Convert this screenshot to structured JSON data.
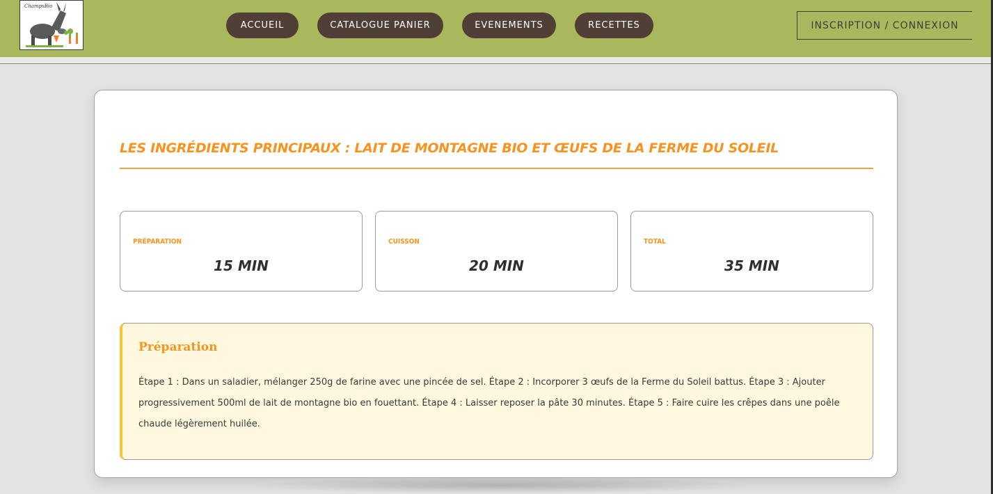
{
  "header": {
    "logo_text": "ChampsBio",
    "nav": {
      "accueil": "ACCUEIL",
      "catalogue": "CATALOGUE PANIER",
      "evenements": "EVENEMENTS",
      "recettes": "RECETTES"
    },
    "login_label": "INSCRIPTION / CONNEXION"
  },
  "recipe": {
    "title": "Les ingrédients principaux : Lait de montagne bio et œufs de la Ferme du Soleil",
    "times": [
      {
        "label": "Préparation",
        "value": "15 min"
      },
      {
        "label": "Cuisson",
        "value": "20 min"
      },
      {
        "label": "Total",
        "value": "35 min"
      }
    ],
    "preparation": {
      "heading": "Préparation",
      "text": "Étape 1 : Dans un saladier, mélanger 250g de farine avec une pincée de sel. Étape 2 : Incorporer 3 œufs de la Ferme du Soleil battus. Étape 3 : Ajouter progressivement 500ml de lait de montagne bio en fouettant. Étape 4 : Laisser reposer la pâte 30 minutes. Étape 5 : Faire cuire les crêpes dans une poêle chaude légèrement huilée."
    }
  },
  "colors": {
    "header_bg": "#a9b85c",
    "nav_bg": "#4f3f37",
    "accent_orange": "#f7931e",
    "prep_bg": "#fff8df",
    "prep_border": "#f6c53a"
  }
}
